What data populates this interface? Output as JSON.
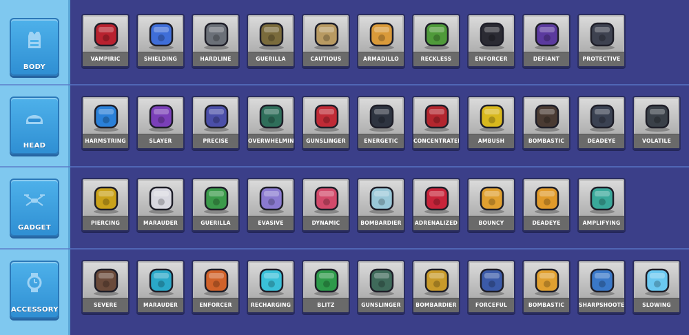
{
  "categories": [
    {
      "label": "BODY",
      "icon": "vest-icon",
      "items": [
        {
          "label": "VAMPIRIC",
          "icon": "red-coat-armor-icon",
          "color": "#b8222f"
        },
        {
          "label": "SHIELDING",
          "icon": "blue-armor-icon",
          "color": "#3f6ed8"
        },
        {
          "label": "HARDLINE",
          "icon": "grey-strap-armor-icon",
          "color": "#6b7078"
        },
        {
          "label": "GUERILLA",
          "icon": "olive-vest-icon",
          "color": "#7a6b3c"
        },
        {
          "label": "CAUTIOUS",
          "icon": "tan-vest-icon",
          "color": "#b89a62"
        },
        {
          "label": "ARMADILLO",
          "icon": "orange-armor-icon",
          "color": "#d99a3a"
        },
        {
          "label": "RECKLESS",
          "icon": "green-star-shirt-icon",
          "color": "#4f9a3a"
        },
        {
          "label": "ENFORCER",
          "icon": "black-harness-icon",
          "color": "#2b2b33"
        },
        {
          "label": "DEFIANT",
          "icon": "purple-jacket-icon",
          "color": "#5b3a9e"
        },
        {
          "label": "PROTECTIVE",
          "icon": "dark-vest-icon",
          "color": "#3e4250"
        }
      ]
    },
    {
      "label": "HEAD",
      "icon": "helmet-icon",
      "items": [
        {
          "label": "HARMSTRING",
          "icon": "blue-goggles-icon",
          "color": "#2a80d8"
        },
        {
          "label": "SLAYER",
          "icon": "skull-headband-icon",
          "color": "#7a3fb8"
        },
        {
          "label": "PRECISE",
          "icon": "visor-icon",
          "color": "#4b4fa8"
        },
        {
          "label": "OVERWHELMING",
          "icon": "green-helmet-icon",
          "color": "#2f6e5a"
        },
        {
          "label": "GUNSLINGER",
          "icon": "red-hat-icon",
          "color": "#c02b36"
        },
        {
          "label": "ENERGETIC",
          "icon": "cap-icon",
          "color": "#2e3440"
        },
        {
          "label": "CONCENTRATED",
          "icon": "beret-icon",
          "color": "#b3262e"
        },
        {
          "label": "AMBUSH",
          "icon": "gold-helmet-icon",
          "color": "#d8b81e"
        },
        {
          "label": "BOMBASTIC",
          "icon": "headphones-icon",
          "color": "#4a3b33"
        },
        {
          "label": "DEADEYE",
          "icon": "binoculars-icon",
          "color": "#3b4252"
        },
        {
          "label": "VOLATILE",
          "icon": "combat-helmet-icon",
          "color": "#3a4048"
        }
      ]
    },
    {
      "label": "GADGET",
      "icon": "drone-icon",
      "items": [
        {
          "label": "PIERCING",
          "icon": "wasp-drone-icon",
          "color": "#caa21a"
        },
        {
          "label": "MARAUDER",
          "icon": "robot-icon",
          "color": "#d8d8e0"
        },
        {
          "label": "GUERILLA",
          "icon": "hover-car-icon",
          "color": "#3b9a4a"
        },
        {
          "label": "EVASIVE",
          "icon": "ufo-icon",
          "color": "#8a7ad0"
        },
        {
          "label": "DYNAMIC",
          "icon": "quadcopter-icon",
          "color": "#d24a6a"
        },
        {
          "label": "BOMBARDIER",
          "icon": "helicopter-icon",
          "color": "#9ac8d8"
        },
        {
          "label": "ADRENALIZED",
          "icon": "jet-icon",
          "color": "#c8243a"
        },
        {
          "label": "BOUNCY",
          "icon": "unicycle-bot-icon",
          "color": "#e0a030"
        },
        {
          "label": "DEADEYE",
          "icon": "orb-drone-icon",
          "color": "#e09a2a"
        },
        {
          "label": "AMPLIFYING",
          "icon": "teal-drone-icon",
          "color": "#3aa89a"
        }
      ]
    },
    {
      "label": "ACCESSORY",
      "icon": "watch-icon",
      "items": [
        {
          "label": "SEVERE",
          "icon": "bracer-icon",
          "color": "#6a4a3a"
        },
        {
          "label": "MARAUDER",
          "icon": "teal-glove-icon",
          "color": "#2aa8c8"
        },
        {
          "label": "ENFORCER",
          "icon": "ammo-belt-icon",
          "color": "#d0622a"
        },
        {
          "label": "RECHARGING",
          "icon": "cyan-wristband-icon",
          "color": "#3ac0d8"
        },
        {
          "label": "BLITZ",
          "icon": "green-band-icon",
          "color": "#2e9a4a"
        },
        {
          "label": "GUNSLINGER",
          "icon": "dark-watch-icon",
          "color": "#3f6a5a"
        },
        {
          "label": "BOMBARDIER",
          "icon": "gold-watch-icon",
          "color": "#c89a2a"
        },
        {
          "label": "FORCEFUL",
          "icon": "blue-glove-icon",
          "color": "#3b5aa8"
        },
        {
          "label": "BOMBASTIC",
          "icon": "gold-ring-icon",
          "color": "#e0a030"
        },
        {
          "label": "SHARPSHOOTER",
          "icon": "scope-bracer-icon",
          "color": "#3a78c8"
        },
        {
          "label": "SLOWING",
          "icon": "ice-gauntlet-icon",
          "color": "#6ac8f0"
        }
      ]
    }
  ]
}
